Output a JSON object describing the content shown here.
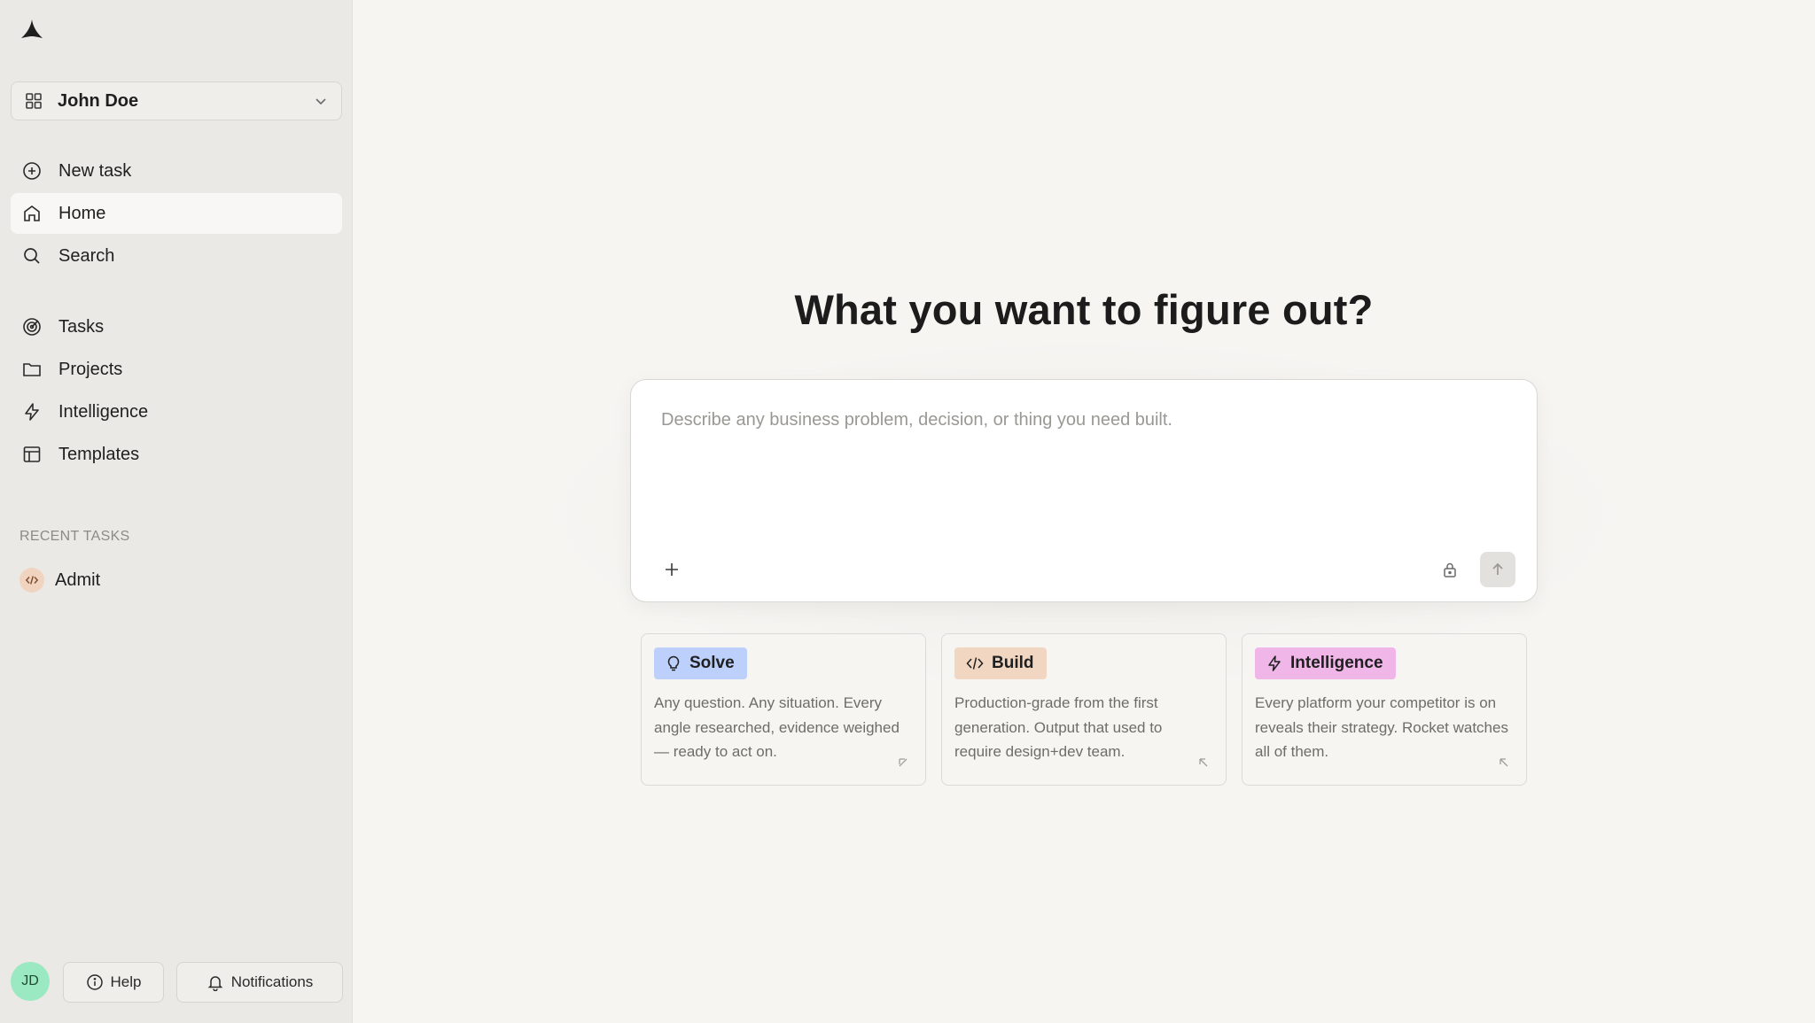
{
  "sidebar": {
    "workspace": {
      "name": "John Doe",
      "icon": "grid-icon"
    },
    "nav": [
      {
        "label": "New task",
        "icon": "plus-circle-icon",
        "active": false
      },
      {
        "label": "Home",
        "icon": "home-icon",
        "active": true
      },
      {
        "label": "Search",
        "icon": "search-icon",
        "active": false
      },
      {
        "label": "Tasks",
        "icon": "target-icon",
        "active": false
      },
      {
        "label": "Projects",
        "icon": "folder-icon",
        "active": false
      },
      {
        "label": "Intelligence",
        "icon": "bolt-icon",
        "active": false
      },
      {
        "label": "Templates",
        "icon": "layout-icon",
        "active": false
      }
    ],
    "recent_title": "RECENT TASKS",
    "recent": [
      {
        "label": "Admit",
        "icon": "code-icon"
      }
    ],
    "footer": {
      "avatar_initials": "JD",
      "help_label": "Help",
      "notifications_label": "Notifications"
    }
  },
  "main": {
    "headline": "What you want to figure out?",
    "composer": {
      "placeholder": "Describe any business problem, decision, or thing you need built."
    },
    "cards": [
      {
        "label": "Solve",
        "icon": "lightbulb-icon",
        "color": "#bcd0fb",
        "description": "Any question. Any situation. Every angle researched, evidence weighed — ready to act on."
      },
      {
        "label": "Build",
        "icon": "code-icon",
        "color": "#f1d6c2",
        "description": "Production-grade from the first generation. Output that used to require design+dev team."
      },
      {
        "label": "Intelligence",
        "icon": "bolt-icon",
        "color": "#efb6e7",
        "description": "Every platform your competitor is on reveals their strategy. Rocket watches all of them."
      }
    ]
  }
}
